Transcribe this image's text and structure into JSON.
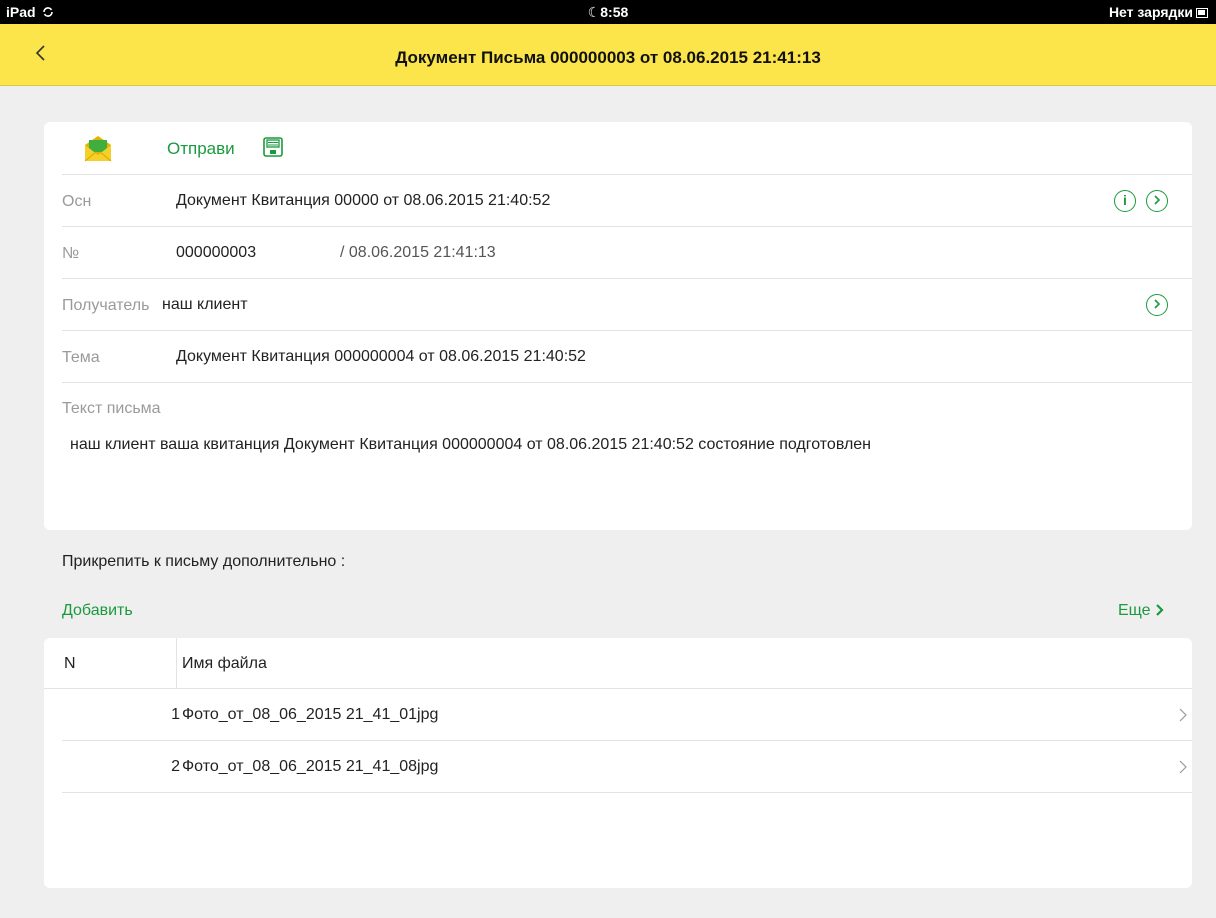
{
  "status_bar": {
    "device": "iPad",
    "time": "8:58",
    "battery_text": "Нет зарядки"
  },
  "nav": {
    "title": "Документ Письма 000000003 от 08.06.2015 21:41:13"
  },
  "toolbar": {
    "send_label": "Отправи"
  },
  "form": {
    "basis": {
      "label": "Осн",
      "value": "Документ Квитанция 00000 от 08.06.2015 21:40:52"
    },
    "number": {
      "label": "№",
      "value": "000000003",
      "date": "/ 08.06.2015 21:41:13"
    },
    "recipient": {
      "label": "Получатель",
      "value": "наш клиент"
    },
    "subject": {
      "label": "Тема",
      "value": "Документ Квитанция 000000004 от 08.06.2015 21:40:52"
    },
    "body": {
      "label": "Текст письма",
      "value": "наш клиент ваша квитанция Документ Квитанция 000000004 от 08.06.2015 21:40:52 состояние подготовлен"
    }
  },
  "attachments": {
    "label": "Прикрепить к письму дополнительно :",
    "add_label": "Добавить",
    "more_label": "Еще",
    "columns": {
      "n": "N",
      "file": "Имя файла"
    },
    "rows": [
      {
        "n": "1",
        "file": "Фото_от_08_06_2015 21_41_01jpg"
      },
      {
        "n": "2",
        "file": "Фото_от_08_06_2015 21_41_08jpg"
      }
    ]
  },
  "colors": {
    "accent": "#1a9a3e",
    "navbar": "#fbe54a",
    "background": "#efefef"
  },
  "icons": [
    "back-chevron-icon",
    "envelope-icon",
    "save-icon",
    "info-icon",
    "open-arrow-icon",
    "chevron-right-icon",
    "moon-icon",
    "sync-icon",
    "battery-icon"
  ]
}
